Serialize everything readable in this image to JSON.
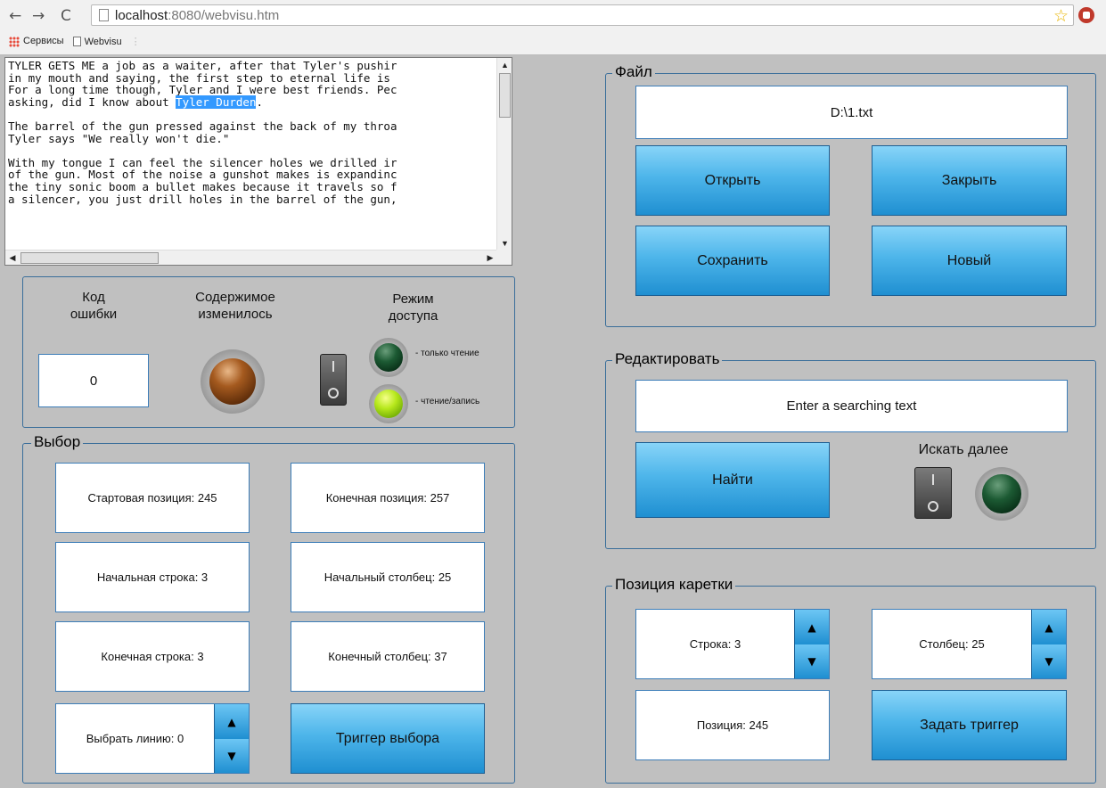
{
  "browser": {
    "url_host": "localhost",
    "url_path": ":8080/webvisu.htm",
    "bookmarks": [
      "Сервисы",
      "Webvisu"
    ]
  },
  "editor": {
    "lines": [
      "TYLER GETS ME a job as a waiter, after that Tyler's pushir",
      "in my mouth and saying, the first step to eternal life is",
      "For a long time though, Tyler and I were best friends. Pec",
      "asking, did I know about ",
      "",
      "The barrel of the gun pressed against the back of my throa",
      "Tyler says \"We really won't die.\"",
      "",
      "With my tongue I can feel the silencer holes we drilled ir",
      "of the gun. Most of the noise a gunshot makes is expandinc",
      "the tiny sonic boom a bullet makes because it travels so f",
      "a silencer, you just drill holes in the barrel of the gun,"
    ],
    "selected": "Tyler Durden",
    "after_selected": "."
  },
  "status": {
    "error_code_label": "Код\nошибки",
    "error_code_value": "0",
    "content_changed_label": "Содержимое\nизменилось",
    "access_mode_label": "Режим\nдоступа",
    "read_only_label": "- только чтение",
    "read_write_label": "- чтение/запись"
  },
  "selection": {
    "title": "Выбор",
    "start_pos": "Стартовая позиция: 245",
    "end_pos": "Конечная позиция: 257",
    "start_line": "Начальная строка: 3",
    "start_col": "Начальный столбец: 25",
    "end_line": "Конечная строка: 3",
    "end_col": "Конечный столбец: 37",
    "select_line": "Выбрать линию: 0",
    "trigger_label": "Триггер выбора"
  },
  "file": {
    "title": "Файл",
    "path": "D:\\1.txt",
    "open_label": "Открыть",
    "close_label": "Закрыть",
    "save_label": "Сохранить",
    "new_label": "Новый"
  },
  "edit": {
    "title": "Редактировать",
    "search_placeholder": "Enter a searching text",
    "find_label": "Найти",
    "find_next_label": "Искать далее"
  },
  "caret": {
    "title": "Позиция  каретки",
    "row": "Строка: 3",
    "column": "Столбец: 25",
    "position": "Позиция: 245",
    "set_trigger_label": "Задать триггер"
  },
  "colors": {
    "background": "#c0c0c0",
    "button_gradient_top": "#88d4f8",
    "button_gradient_bottom": "#1f8fd1",
    "selection": "#3399ff"
  }
}
